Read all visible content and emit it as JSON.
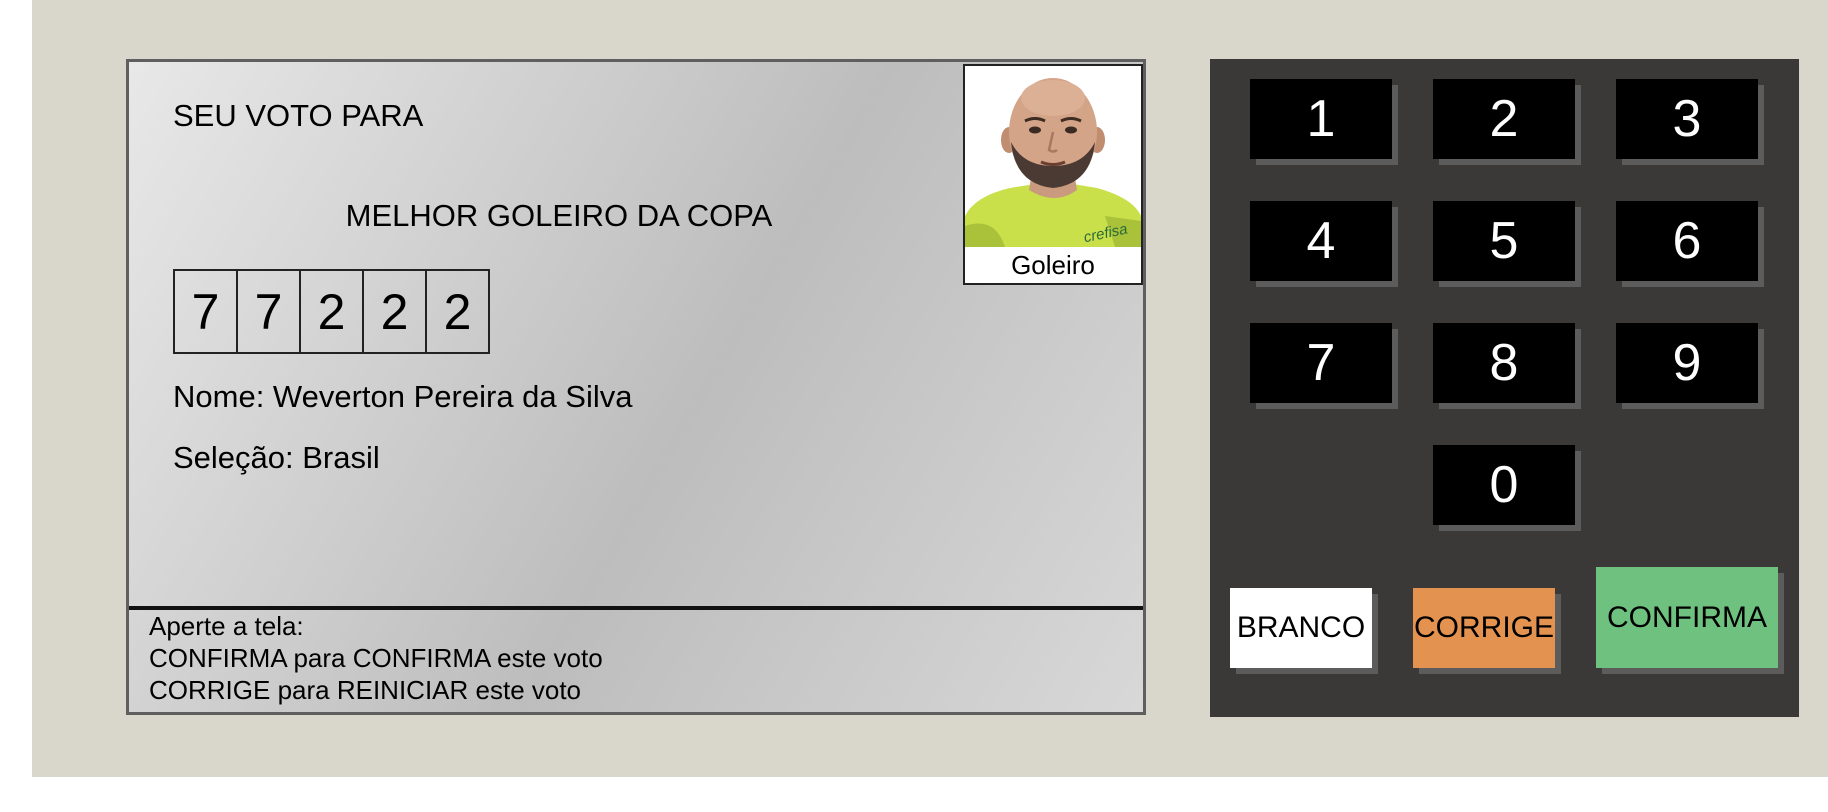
{
  "screen": {
    "title": "SEU VOTO PARA",
    "office": "MELHOR GOLEIRO DA COPA",
    "digits": [
      "7",
      "7",
      "2",
      "2",
      "2"
    ],
    "name_line": "Nome: Weverton Pereira da Silva",
    "nation_line": "Seleção: Brasil",
    "candidate": {
      "role_caption": "Goleiro",
      "shirt_text": "crefisa"
    },
    "instructions": [
      "Aperte a tela:",
      "CONFIRMA para CONFIRMA este voto",
      "CORRIGE para REINICIAR este voto"
    ]
  },
  "keypad": {
    "keys": [
      "1",
      "2",
      "3",
      "4",
      "5",
      "6",
      "7",
      "8",
      "9",
      "0"
    ],
    "branco_label": "BRANCO",
    "corrige_label": "CORRIGE",
    "confirma_label": "CONFIRMA"
  },
  "colors": {
    "background": "#d9d6cc",
    "keypad": "#3b3938",
    "corrige": "#e3924f",
    "confirma": "#6ec17e",
    "branco": "#ffffff"
  }
}
